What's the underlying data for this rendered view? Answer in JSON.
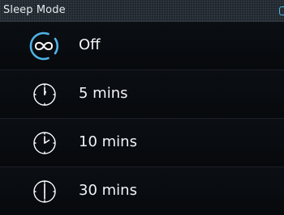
{
  "header": {
    "title": "Sleep Mode"
  },
  "menu": {
    "items": [
      {
        "label": "Off",
        "icon": "infinity-icon",
        "selected": true
      },
      {
        "label": "5 mins",
        "icon": "clock-icon"
      },
      {
        "label": "10 mins",
        "icon": "clock-icon"
      },
      {
        "label": "30 mins",
        "icon": "clock-icon"
      }
    ]
  },
  "colors": {
    "background": "#05080c",
    "titlebar": "#1f262e",
    "accent": "#4fb5e8",
    "text": "#f2f4f6"
  }
}
